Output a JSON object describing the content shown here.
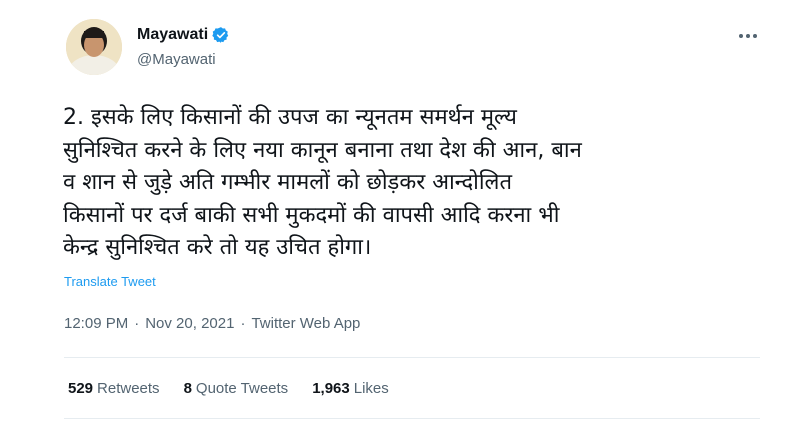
{
  "author": {
    "name": "Mayawati",
    "handle": "@Mayawati"
  },
  "tweet": {
    "text": "2. इसके लिए किसानों की उपज का न्यूनतम समर्थन मूल्य\nसुनिश्चित करने के लिए नया कानून बनाना तथा देश की आन, बान\nव शान से जुड़े अति गम्भीर मामलों को छोड़कर आन्दोलित\nकिसानों पर दर्ज बाकी सभी मुकदमों की वापसी आदि करना भी\nकेन्द्र सुनिश्चित करे तो यह उचित होगा।",
    "translate_label": "Translate Tweet"
  },
  "meta": {
    "time": "12:09 PM",
    "separator": "·",
    "date": "Nov 20, 2021",
    "source": "Twitter Web App"
  },
  "stats": {
    "retweets_count": "529",
    "retweets_label": "Retweets",
    "quotes_count": "8",
    "quotes_label": "Quote Tweets",
    "likes_count": "1,963",
    "likes_label": "Likes"
  },
  "icons": {
    "verified": "verified-badge-icon",
    "more": "more-options-icon"
  },
  "colors": {
    "accent": "#1d9bf0",
    "secondary_text": "#536471",
    "primary_text": "#0f1419"
  }
}
